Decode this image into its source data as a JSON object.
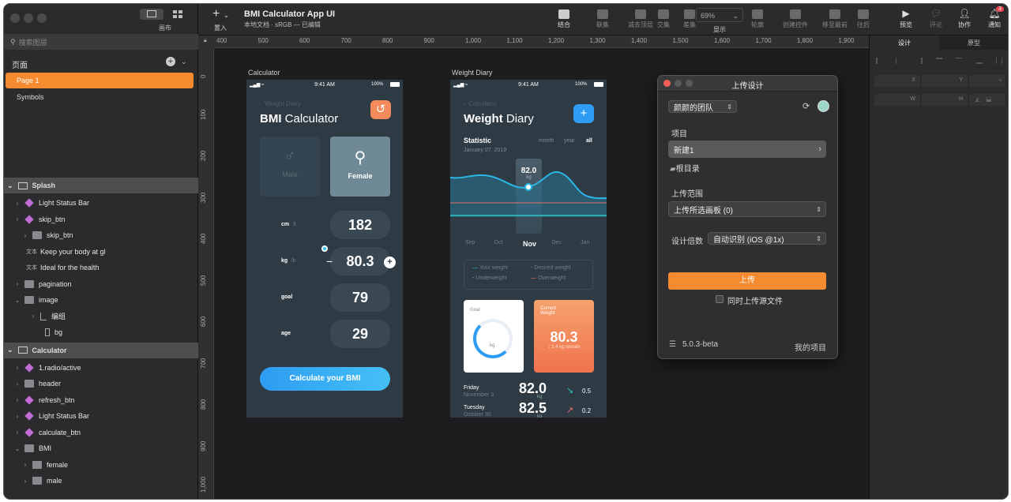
{
  "window": {
    "title": "BMI Calculator App UI",
    "subtitle": "本地文档 · sRGB — 已编辑"
  },
  "left": {
    "canvas_label": "画布",
    "search_placeholder": "搜索图层",
    "pages_title": "页面",
    "pages": [
      "Page 1",
      "Symbols"
    ]
  },
  "groups": [
    {
      "name": "Splash",
      "items": [
        {
          "label": "Light Status Bar",
          "icon": "symbol"
        },
        {
          "label": "skip_btn",
          "icon": "symbol"
        },
        {
          "label": "skip_btn",
          "icon": "folder"
        },
        {
          "label": "Keep your body at gl",
          "icon": "text",
          "prefix": "文本"
        },
        {
          "label": "Ideal for the health",
          "icon": "text",
          "prefix": "文本"
        },
        {
          "label": "pagination",
          "icon": "folder"
        },
        {
          "label": "image",
          "icon": "folder"
        },
        {
          "label": "编组",
          "icon": "group"
        },
        {
          "label": "bg",
          "icon": "rect"
        }
      ]
    },
    {
      "name": "Calculator",
      "items": [
        {
          "label": "1.radio/active",
          "icon": "symbol"
        },
        {
          "label": "header",
          "icon": "folder"
        },
        {
          "label": "refresh_btn",
          "icon": "symbol"
        },
        {
          "label": "Light Status Bar",
          "icon": "symbol"
        },
        {
          "label": "calculate_btn",
          "icon": "symbol"
        },
        {
          "label": "BMI",
          "icon": "folder"
        },
        {
          "label": "female",
          "icon": "folder"
        },
        {
          "label": "male",
          "icon": "folder"
        }
      ]
    }
  ],
  "toolbar": {
    "insert": "置入",
    "zoom": "69%",
    "display": "显示",
    "buttons": [
      "结合",
      "联集",
      "减去顶层",
      "交集",
      "差集",
      "轮廓",
      "创建控件",
      "移至最前",
      "往后"
    ],
    "right": [
      "预览",
      "评论",
      "协作",
      "通知"
    ],
    "notify_count": "3"
  },
  "ruler": {
    "h": [
      "400",
      "500",
      "600",
      "700",
      "800",
      "900",
      "1,000",
      "1,100",
      "1,200",
      "1,300",
      "1,400",
      "1,500",
      "1,600",
      "1,700",
      "1,800",
      "1,900"
    ],
    "v": [
      "0",
      "100",
      "200",
      "300",
      "400",
      "500",
      "600",
      "700",
      "800",
      "900",
      "1,000"
    ]
  },
  "right": {
    "tabs": [
      "设计",
      "原型"
    ],
    "fields": [
      "X",
      "Y",
      "W",
      "H"
    ]
  },
  "calc": {
    "label": "Calculator",
    "time": "9:41 AM",
    "battery": "100%",
    "back": "Weight Diary",
    "title_bold": "BMI",
    "title_rest": "Calculator",
    "male": "Male",
    "female": "Female",
    "rows": [
      {
        "label": "cm",
        "unit": "ft",
        "value": "182"
      },
      {
        "label": "kg",
        "unit": "lb",
        "value": "80.3"
      },
      {
        "label": "goal",
        "unit": "",
        "value": "79"
      },
      {
        "label": "age",
        "unit": "",
        "value": "29"
      }
    ],
    "minus": "−",
    "plus": "+",
    "button": "Calculate your BMI"
  },
  "diary": {
    "label": "Weight Diary",
    "time": "9:41 AM",
    "battery": "100%",
    "back": "Calculator",
    "title_bold": "Weight",
    "title_rest": "Diary",
    "statistic": "Statistic",
    "date": "January 07, 2019",
    "ranges": [
      "month",
      "year",
      "all"
    ],
    "peak_value": "82.0",
    "peak_unit": "kg",
    "months": [
      "Sep",
      "Oct",
      "Nov",
      "Dec",
      "Jan"
    ],
    "legend": [
      "Your weight",
      "Desired weight",
      "Underweight",
      "Overweight"
    ],
    "goal": "Goal",
    "goal_unit": "kg",
    "current": "Current\nWeight",
    "current_value": "80.3",
    "current_sub": "↓ 1.4 kg remain",
    "entries": [
      {
        "day": "Friday",
        "date": "November 3",
        "value": "82.0",
        "unit": "kg",
        "delta": "0.5",
        "arrow": "↘"
      },
      {
        "day": "Tuesday",
        "date": "October 30",
        "value": "82.5",
        "unit": "kg",
        "delta": "0.2",
        "arrow": "↗"
      }
    ]
  },
  "upload": {
    "title": "上传设计",
    "team": "颜颜的团队",
    "project_label": "项目",
    "project": "新建1",
    "root": "根目录",
    "scope_label": "上传范围",
    "scope": "上传所选画板 (0)",
    "scale_label": "设计倍数",
    "scale": "自动识别 (iOS @1x)",
    "button": "上传",
    "checkbox": "同时上传源文件",
    "version": "5.0.3-beta",
    "my_projects": "我的项目"
  },
  "colors": {
    "accent": "#f58a2f",
    "artboard": "#2e3a44",
    "blue": "#2e9cf2"
  }
}
